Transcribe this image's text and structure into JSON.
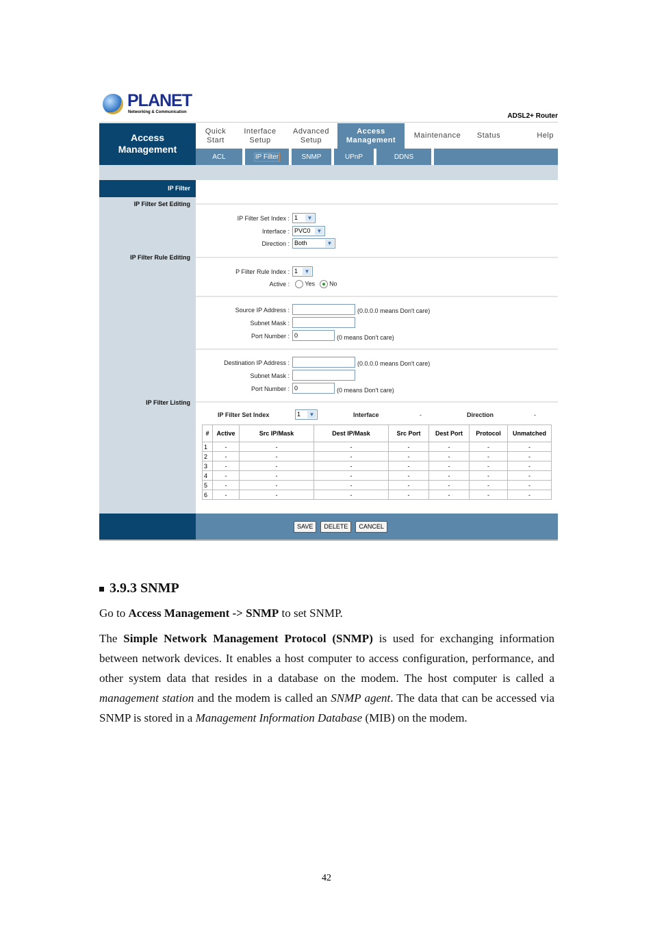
{
  "header": {
    "logo_text": "PLANET",
    "logo_sub": "Networking & Communication",
    "product": "ADSL2+ Router"
  },
  "nav": {
    "section_title_line1": "Access",
    "section_title_line2": "Management",
    "tabs": [
      {
        "line1": "Quick",
        "line2": "Start"
      },
      {
        "line1": "Interface",
        "line2": "Setup"
      },
      {
        "line1": "Advanced",
        "line2": "Setup"
      },
      {
        "line1": "Access",
        "line2": "Management"
      },
      {
        "line1": "Maintenance",
        "line2": ""
      },
      {
        "line1": "Status",
        "line2": ""
      },
      {
        "line1": "Help",
        "line2": ""
      }
    ],
    "subtabs": [
      "ACL",
      "IP Filter",
      "SNMP",
      "UPnP",
      "DDNS"
    ]
  },
  "side": {
    "active": "IP Filter",
    "set_editing": "IP Filter Set Editing",
    "rule_editing": "IP Filter Rule Editing",
    "listing": "IP Filter Listing"
  },
  "form": {
    "set_index_label": "IP Filter Set Index :",
    "set_index_value": "1",
    "interface_label": "Interface :",
    "interface_value": "PVC0",
    "direction_label": "Direction :",
    "direction_value": "Both",
    "rule_index_label": "P Filter Rule Index :",
    "rule_index_value": "1",
    "active_label": "Active :",
    "active_yes": "Yes",
    "active_no": "No",
    "src_ip_label": "Source IP Address :",
    "src_ip_value": "",
    "src_ip_hint": "(0.0.0.0 means Don't care)",
    "src_mask_label": "Subnet Mask :",
    "src_mask_value": "",
    "src_port_label": "Port Number :",
    "src_port_value": "0",
    "src_port_hint": "(0 means Don't care)",
    "dst_ip_label": "Destination IP Address :",
    "dst_ip_value": "",
    "dst_ip_hint": "(0.0.0.0 means Don't care)",
    "dst_mask_label": "Subnet Mask :",
    "dst_mask_value": "",
    "dst_port_label": "Port Number :",
    "dst_port_value": "0",
    "dst_port_hint": "(0 means Don't care)"
  },
  "listing": {
    "set_index_label": "IP Filter Set Index",
    "set_index_value": "1",
    "interface_label": "Interface",
    "interface_value": "-",
    "direction_label": "Direction",
    "direction_value": "-",
    "columns": [
      "#",
      "Active",
      "Src IP/Mask",
      "Dest IP/Mask",
      "Src Port",
      "Dest Port",
      "Protocol",
      "Unmatched"
    ],
    "rows": [
      [
        "1",
        "-",
        "-",
        "-",
        "-",
        "-",
        "-",
        "-"
      ],
      [
        "2",
        "-",
        "-",
        "-",
        "-",
        "-",
        "-",
        "-"
      ],
      [
        "3",
        "-",
        "-",
        "-",
        "-",
        "-",
        "-",
        "-"
      ],
      [
        "4",
        "-",
        "-",
        "-",
        "-",
        "-",
        "-",
        "-"
      ],
      [
        "5",
        "-",
        "-",
        "-",
        "-",
        "-",
        "-",
        "-"
      ],
      [
        "6",
        "-",
        "-",
        "-",
        "-",
        "-",
        "-",
        "-"
      ]
    ]
  },
  "buttons": {
    "save": "SAVE",
    "delete": "DELETE",
    "cancel": "CANCEL"
  },
  "doc": {
    "heading": "3.9.3 SNMP",
    "p1_a": "Go to ",
    "p1_b": "Access Management -> SNMP",
    "p1_c": " to set SNMP.",
    "p2_a": "The ",
    "p2_b": "Simple Network Management Protocol (SNMP)",
    "p2_c": " is used for exchanging information between network devices. It enables a host computer to access configuration, performance, and other system data that resides in a database on the modem. The host computer is called a ",
    "p2_d": "management station",
    "p2_e": " and the modem is called an ",
    "p2_f": "SNMP agent",
    "p2_g": ". The data that can be accessed via SNMP is stored in a ",
    "p2_h": "Management Information Database",
    "p2_i": " (MIB) on the modem."
  },
  "page_number": "42"
}
